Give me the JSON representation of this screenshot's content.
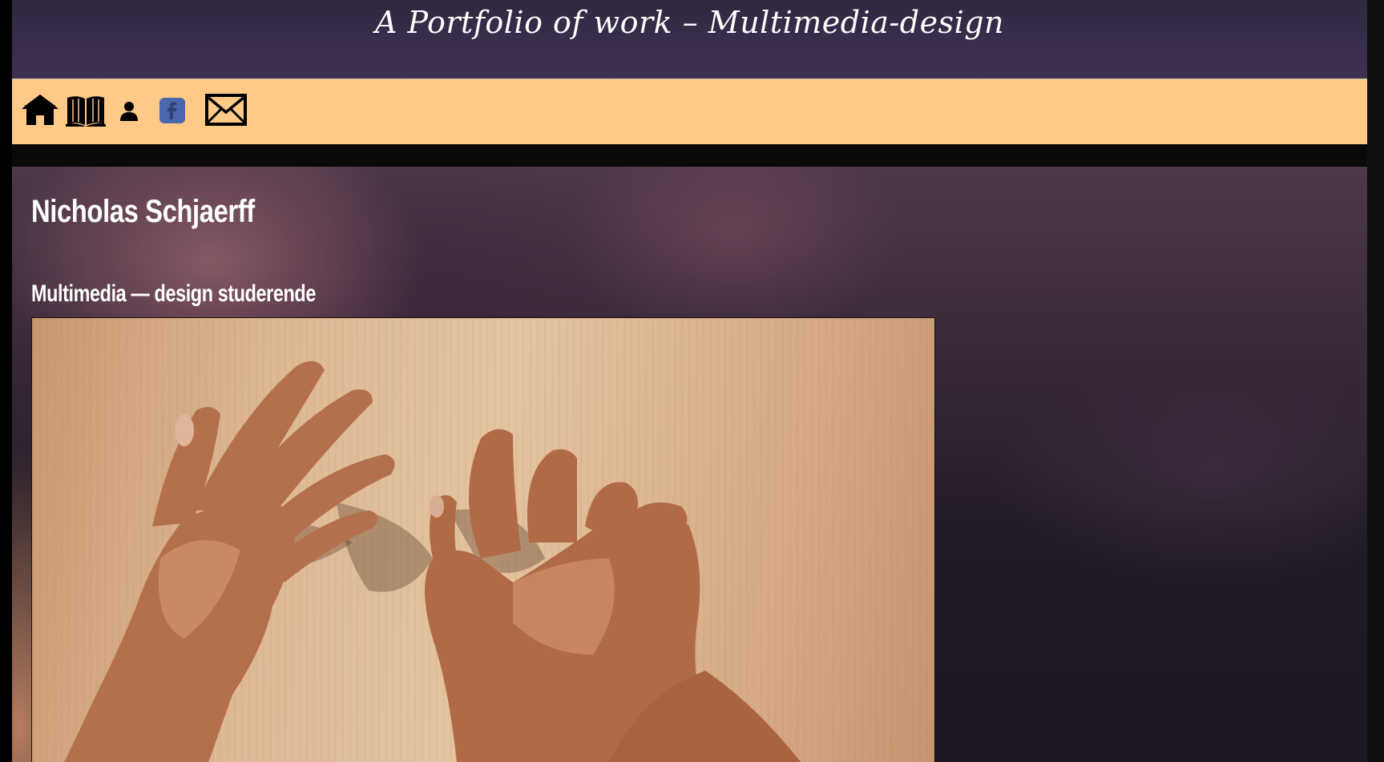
{
  "header": {
    "title": "A Portfolio of work – Multimedia-design"
  },
  "nav": {
    "items": [
      {
        "icon": "home-icon"
      },
      {
        "icon": "book-icon"
      },
      {
        "icon": "user-icon"
      },
      {
        "icon": "facebook-icon"
      },
      {
        "icon": "mail-icon"
      }
    ],
    "background_color": "#ffc987",
    "facebook_color": "#4a67ad"
  },
  "main": {
    "name": "Nicholas Schjaerff",
    "subtitle": "Multimedia — design studerende"
  },
  "colors": {
    "header_bg": "#3a2e4d",
    "title_color": "#ffffff"
  }
}
